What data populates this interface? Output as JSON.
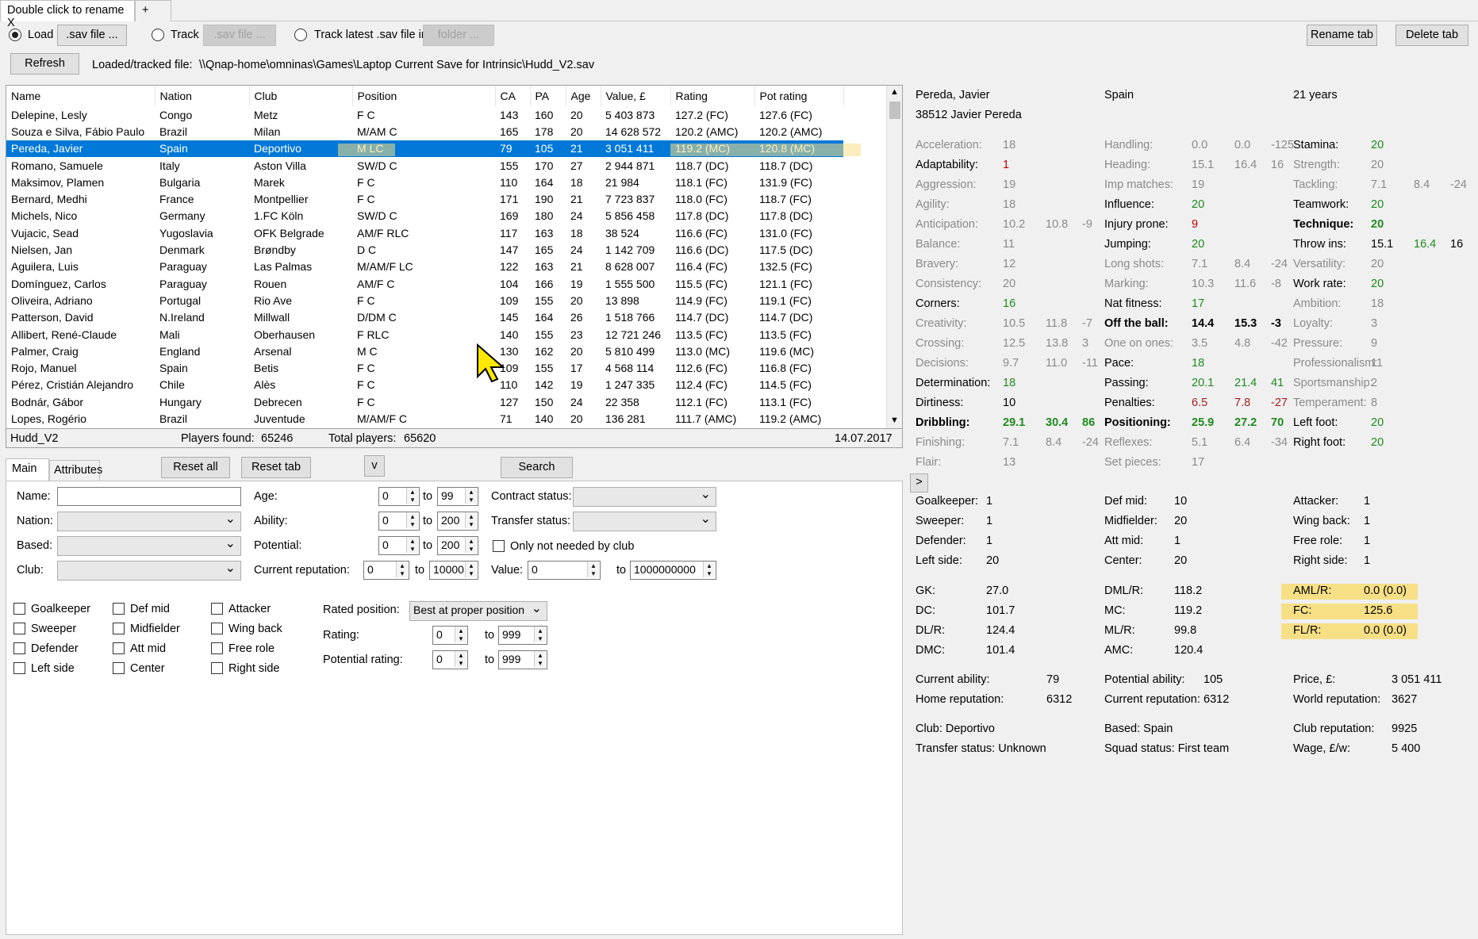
{
  "tabs": {
    "active": "Double click to rename X",
    "add": "+"
  },
  "top": {
    "load_label": "Load",
    "sav_file": ".sav file ...",
    "track_label": "Track",
    "sav_file2": ".sav file ...",
    "track_latest": "Track latest .sav file in",
    "folder": "folder ...",
    "rename_tab": "Rename tab",
    "delete_tab": "Delete tab",
    "refresh": "Refresh",
    "loaded_label": "Loaded/tracked file:",
    "loaded_path": "\\\\Qnap-home\\omninas\\Games\\Laptop Current Save for Intrinsic\\Hudd_V2.sav"
  },
  "columns": [
    "Name",
    "Nation",
    "Club",
    "Position",
    "CA",
    "PA",
    "Age",
    "Value, £",
    "Rating",
    "Pot rating"
  ],
  "rows": [
    [
      "Delepine, Lesly",
      "Congo",
      "Metz",
      "F C",
      "143",
      "160",
      "20",
      "5 403 873",
      "127.2 (FC)",
      "127.6 (FC)"
    ],
    [
      "Souza e Silva, Fábio Paulo",
      "Brazil",
      "Milan",
      "M/AM C",
      "165",
      "178",
      "20",
      "14 628 572",
      "120.2 (AMC)",
      "120.2 (AMC)"
    ],
    [
      "Pereda, Javier",
      "Spain",
      "Deportivo",
      "M LC",
      "79",
      "105",
      "21",
      "3 051 411",
      "119.2 (MC)",
      "120.8 (MC)"
    ],
    [
      "Romano, Samuele",
      "Italy",
      "Aston Villa",
      "SW/D C",
      "155",
      "170",
      "27",
      "2 944 871",
      "118.7 (DC)",
      "118.7 (DC)"
    ],
    [
      "Maksimov, Plamen",
      "Bulgaria",
      "Marek",
      "F C",
      "110",
      "164",
      "18",
      "21 984",
      "118.1 (FC)",
      "131.9 (FC)"
    ],
    [
      "Bernard, Medhi",
      "France",
      "Montpellier",
      "F C",
      "171",
      "190",
      "21",
      "7 723 837",
      "118.0 (FC)",
      "118.7 (FC)"
    ],
    [
      "Michels, Nico",
      "Germany",
      "1.FC Köln",
      "SW/D C",
      "169",
      "180",
      "24",
      "5 856 458",
      "117.8 (DC)",
      "117.8 (DC)"
    ],
    [
      "Vujacic, Sead",
      "Yugoslavia",
      "OFK Belgrade",
      "AM/F RLC",
      "117",
      "163",
      "18",
      "38 524",
      "116.6 (FC)",
      "131.0 (FC)"
    ],
    [
      "Nielsen, Jan",
      "Denmark",
      "Brøndby",
      "D C",
      "147",
      "165",
      "24",
      "1 142 709",
      "116.6 (DC)",
      "117.5 (DC)"
    ],
    [
      "Aguilera, Luis",
      "Paraguay",
      "Las Palmas",
      "M/AM/F LC",
      "122",
      "163",
      "21",
      "8 628 007",
      "116.4 (FC)",
      "132.5 (FC)"
    ],
    [
      "Domínguez, Carlos",
      "Paraguay",
      "Rouen",
      "AM/F C",
      "104",
      "166",
      "19",
      "1 555 500",
      "115.5 (FC)",
      "121.1 (FC)"
    ],
    [
      "Oliveira, Adriano",
      "Portugal",
      "Rio Ave",
      "F C",
      "109",
      "155",
      "20",
      "13 898",
      "114.9 (FC)",
      "119.1 (FC)"
    ],
    [
      "Patterson, David",
      "N.Ireland",
      "Millwall",
      "D/DM C",
      "145",
      "164",
      "26",
      "1 518 766",
      "114.7 (DC)",
      "114.7 (DC)"
    ],
    [
      "Allibert, René-Claude",
      "Mali",
      "Oberhausen",
      "F RLC",
      "140",
      "155",
      "23",
      "12 721 246",
      "113.5 (FC)",
      "113.5 (FC)"
    ],
    [
      "Palmer, Craig",
      "England",
      "Arsenal",
      "M C",
      "130",
      "162",
      "20",
      "5 810 499",
      "113.0 (MC)",
      "119.6 (MC)"
    ],
    [
      "Rojo, Manuel",
      "Spain",
      "Betis",
      "F C",
      "109",
      "155",
      "17",
      "4 568 114",
      "112.6 (FC)",
      "116.8 (FC)"
    ],
    [
      "Pérez, Cristián Alejandro",
      "Chile",
      "Alès",
      "F C",
      "110",
      "142",
      "19",
      "1 247 335",
      "112.4 (FC)",
      "114.5 (FC)"
    ],
    [
      "Bodnár, Gábor",
      "Hungary",
      "Debrecen",
      "F C",
      "127",
      "150",
      "24",
      "22 358",
      "112.1 (FC)",
      "113.1 (FC)"
    ],
    [
      "Lopes, Rogério",
      "Brazil",
      "Juventude",
      "M/AM/F C",
      "71",
      "140",
      "20",
      "136 281",
      "111.7 (AMC)",
      "119.2 (AMC)"
    ]
  ],
  "status": {
    "save": "Hudd_V2",
    "found_label": "Players found:",
    "found": "65246",
    "total_label": "Total players:",
    "total": "65620",
    "date": "14.07.2017"
  },
  "filter_tabs": {
    "main": "Main",
    "attributes": "Attributes",
    "reset_all": "Reset all",
    "reset_tab": "Reset tab",
    "v": "v",
    "search": "Search"
  },
  "filters": {
    "name": "Name:",
    "nation": "Nation:",
    "based": "Based:",
    "club": "Club:",
    "age": "Age:",
    "ability": "Ability:",
    "potential": "Potential:",
    "cur_rep": "Current reputation:",
    "contract": "Contract status:",
    "transfer": "Transfer status:",
    "only_not_needed": "Only not needed by club",
    "value": "Value:",
    "to": "to",
    "age_min": "0",
    "age_max": "99",
    "ab_min": "0",
    "ab_max": "200",
    "pot_min": "0",
    "pot_max": "200",
    "rep_min": "0",
    "rep_max": "10000",
    "val_min": "0",
    "val_max": "1000000000",
    "rated_pos": "Rated position:",
    "rated_pos_val": "Best at proper position",
    "rating": "Rating:",
    "pot_rating": "Potential rating:",
    "r_min": "0",
    "r_max": "999",
    "pr_min": "0",
    "pr_max": "999",
    "positions": [
      "Goalkeeper",
      "Def mid",
      "Attacker",
      "Sweeper",
      "Midfielder",
      "Wing back",
      "Defender",
      "Att mid",
      "Free role",
      "Left side",
      "Center",
      "Right side"
    ]
  },
  "player": {
    "name": "Pereda, Javier",
    "nation": "Spain",
    "age": "21 years",
    "id_name": "38512 Javier Pereda",
    "col1": [
      [
        "Acceleration:",
        "18"
      ],
      [
        "Adaptability:",
        "1"
      ],
      [
        "Aggression:",
        "19"
      ],
      [
        "Agility:",
        "18"
      ],
      [
        "Anticipation:",
        "10.2",
        "10.8",
        "-9"
      ],
      [
        "Balance:",
        "11"
      ],
      [
        "Bravery:",
        "12"
      ],
      [
        "Consistency:",
        "20"
      ],
      [
        "Corners:",
        "16"
      ],
      [
        "Creativity:",
        "10.5",
        "11.8",
        "-7"
      ],
      [
        "Crossing:",
        "12.5",
        "13.8",
        "3"
      ],
      [
        "Decisions:",
        "9.7",
        "11.0",
        "-11"
      ],
      [
        "Determination:",
        "18"
      ],
      [
        "Dirtiness:",
        "10"
      ],
      [
        "Dribbling:",
        "29.1",
        "30.4",
        "86"
      ],
      [
        "Finishing:",
        "7.1",
        "8.4",
        "-24"
      ],
      [
        "Flair:",
        "13"
      ]
    ],
    "col2": [
      [
        "Handling:",
        "0.0",
        "0.0",
        "-125"
      ],
      [
        "Heading:",
        "15.1",
        "16.4",
        "16"
      ],
      [
        "Imp matches:",
        "19"
      ],
      [
        "Influence:",
        "20"
      ],
      [
        "Injury prone:",
        "9"
      ],
      [
        "Jumping:",
        "20"
      ],
      [
        "Long shots:",
        "7.1",
        "8.4",
        "-24"
      ],
      [
        "Marking:",
        "10.3",
        "11.6",
        "-8"
      ],
      [
        "Nat fitness:",
        "17"
      ],
      [
        "Off the ball:",
        "14.4",
        "15.3",
        "-3"
      ],
      [
        "One on ones:",
        "3.5",
        "4.8",
        "-42"
      ],
      [
        "Pace:",
        "18"
      ],
      [
        "Passing:",
        "20.1",
        "21.4",
        "41"
      ],
      [
        "Penalties:",
        "6.5",
        "7.8",
        "-27"
      ],
      [
        "Positioning:",
        "25.9",
        "27.2",
        "70"
      ],
      [
        "Reflexes:",
        "5.1",
        "6.4",
        "-34"
      ],
      [
        "Set pieces:",
        "17"
      ]
    ],
    "col3": [
      [
        "Stamina:",
        "20"
      ],
      [
        "Strength:",
        "20"
      ],
      [
        "Tackling:",
        "7.1",
        "8.4",
        "-24"
      ],
      [
        "Teamwork:",
        "20"
      ],
      [
        "Technique:",
        "20"
      ],
      [
        "Throw ins:",
        "15.1",
        "16.4",
        "16"
      ],
      [
        "Versatility:",
        "20"
      ],
      [
        "Work rate:",
        "20"
      ],
      [
        "Ambition:",
        "18"
      ],
      [
        "Loyalty:",
        "3"
      ],
      [
        "Pressure:",
        "9"
      ],
      [
        "Professionalism:",
        "11"
      ],
      [
        "Sportsmanship:",
        "2"
      ],
      [
        "Temperament:",
        "8"
      ],
      [
        "Left foot:",
        "20"
      ],
      [
        "Right foot:",
        "20"
      ]
    ],
    "expand": ">",
    "pos": [
      [
        "Goalkeeper:",
        "1",
        "Def mid:",
        "10",
        "Attacker:",
        "1"
      ],
      [
        "Sweeper:",
        "1",
        "Midfielder:",
        "20",
        "Wing back:",
        "1"
      ],
      [
        "Defender:",
        "1",
        "Att mid:",
        "1",
        "Free role:",
        "1"
      ],
      [
        "Left side:",
        "20",
        "Center:",
        "20",
        "Right side:",
        "1"
      ]
    ],
    "ratings": [
      [
        "GK:",
        "27.0",
        "DML/R:",
        "118.2",
        "AML/R:",
        "0.0 (0.0)"
      ],
      [
        "DC:",
        "101.7",
        "MC:",
        "119.2",
        "FC:",
        "125.6"
      ],
      [
        "DL/R:",
        "124.4",
        "ML/R:",
        "99.8",
        "FL/R:",
        "0.0 (0.0)"
      ],
      [
        "DMC:",
        "101.4",
        "AMC:",
        "120.4",
        "",
        ""
      ]
    ],
    "info": [
      [
        "Current ability:",
        "79",
        "Potential ability:",
        "105",
        "Price, £:",
        "3 051 411"
      ],
      [
        "Home reputation:",
        "6312",
        "Current reputation:",
        "6312",
        "World reputation:",
        "3627"
      ]
    ],
    "club": [
      [
        "Club: Deportivo",
        "",
        "Based: Spain",
        "",
        "Club reputation:",
        "9925"
      ],
      [
        "Transfer status:  Unknown",
        "",
        "Squad status:  First team",
        "",
        "Wage, £/w:",
        "5 400"
      ]
    ]
  }
}
